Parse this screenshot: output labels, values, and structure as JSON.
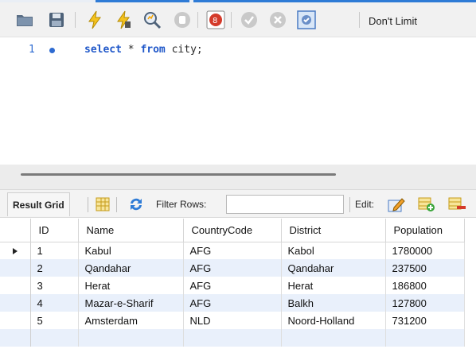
{
  "toolbar": {
    "icons": [
      "open-folder-icon",
      "save-icon",
      "execute-icon",
      "execute-current-icon",
      "explain-icon",
      "stop-icon",
      "toggle-continue-on-error-icon",
      "commit-icon",
      "rollback-icon",
      "autocommit-icon"
    ],
    "limit_label": "Don't Limit"
  },
  "editor": {
    "line_number": "1",
    "code": {
      "kw1": "select",
      "plain1": " * ",
      "kw2": "from",
      "plain2": " city;"
    }
  },
  "result_bar": {
    "tab_label": "Result Grid",
    "filter_label": "Filter Rows:",
    "filter_value": "",
    "edit_label": "Edit:"
  },
  "grid": {
    "columns": [
      "ID",
      "Name",
      "CountryCode",
      "District",
      "Population"
    ],
    "rows": [
      [
        "1",
        "Kabul",
        "AFG",
        "Kabol",
        "1780000"
      ],
      [
        "2",
        "Qandahar",
        "AFG",
        "Qandahar",
        "237500"
      ],
      [
        "3",
        "Herat",
        "AFG",
        "Herat",
        "186800"
      ],
      [
        "4",
        "Mazar-e-Sharif",
        "AFG",
        "Balkh",
        "127800"
      ],
      [
        "5",
        "Amsterdam",
        "NLD",
        "Noord-Holland",
        "731200"
      ]
    ]
  },
  "colors": {
    "accent": "#2e7bd6",
    "keyword": "#1f57c9",
    "row_alt": "#e9f0fb"
  }
}
